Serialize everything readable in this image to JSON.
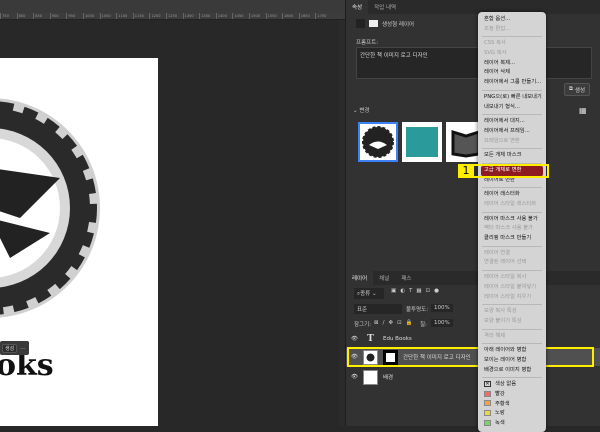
{
  "ruler": [
    "750",
    "800",
    "850",
    "900",
    "950",
    "1000",
    "1050",
    "1100",
    "1150",
    "1200",
    "1250",
    "1300",
    "1350",
    "1400",
    "1450",
    "1500",
    "1550",
    "1600",
    "1650",
    "1700"
  ],
  "canvas": {
    "text": "oks",
    "ctx_button": "생성",
    "ctx_more": "..."
  },
  "properties": {
    "tabs": [
      "속성",
      "작업 내역"
    ],
    "layer_type": "생성형 레이어",
    "prompt_label": "프롬프트:",
    "prompt_value": "간단한 책 이미지 로고 디자인",
    "generate_button": "생성",
    "variations_label": "변경"
  },
  "layers_panel": {
    "tabs": [
      "레이어",
      "채널",
      "패스"
    ],
    "filter": "종류",
    "blend_mode": "표준",
    "opacity_label": "불투명도:",
    "opacity": "100%",
    "lock_label": "잠그기:",
    "fill_label": "칠:",
    "fill": "100%",
    "layers": [
      {
        "name": "Edu Books",
        "type": "text"
      },
      {
        "name": "간단한 책 이미지 로고 디자인",
        "type": "generative",
        "selected": true
      },
      {
        "name": "배경",
        "type": "background"
      }
    ]
  },
  "annotation": {
    "step": "1"
  },
  "context_menu": [
    {
      "label": "혼합 옵션..."
    },
    {
      "label": "조정 편집...",
      "disabled": true
    },
    {
      "sep": true
    },
    {
      "label": "CSS 복사",
      "disabled": true
    },
    {
      "label": "SVG 복사",
      "disabled": true
    },
    {
      "label": "레이어 복제..."
    },
    {
      "label": "레이어 삭제"
    },
    {
      "label": "레이어에서 그룹 만들기..."
    },
    {
      "sep": true
    },
    {
      "label": "PNG으(로) 빠른 내보내기"
    },
    {
      "label": "내보내기 형식..."
    },
    {
      "sep": true
    },
    {
      "label": "레이어에서 대지..."
    },
    {
      "label": "레이어에서 프레임..."
    },
    {
      "label": "프레임으로 변환",
      "disabled": true
    },
    {
      "sep": true
    },
    {
      "label": "모든 개체 마스크"
    },
    {
      "sep": true
    },
    {
      "label": "고급 개체로 변환",
      "highlighted": true
    },
    {
      "label": "레이어로 변환"
    },
    {
      "sep": true
    },
    {
      "label": "레이어 래스터화"
    },
    {
      "label": "레이어 스타일 래스터화",
      "disabled": true
    },
    {
      "sep": true
    },
    {
      "label": "레이어 마스크 사용 불가"
    },
    {
      "label": "벡터 마스크 사용 불가",
      "disabled": true
    },
    {
      "label": "클리핑 마스크 만들기"
    },
    {
      "sep": true
    },
    {
      "label": "레이어 연결",
      "disabled": true
    },
    {
      "label": "연결된 레이어 선택",
      "disabled": true
    },
    {
      "sep": true
    },
    {
      "label": "레이어 스타일 복사",
      "disabled": true
    },
    {
      "label": "레이어 스타일 붙여넣기",
      "disabled": true
    },
    {
      "label": "레이어 스타일 지우기",
      "disabled": true
    },
    {
      "sep": true
    },
    {
      "label": "모양 복사 특성",
      "disabled": true
    },
    {
      "label": "모양 붙이기 특성",
      "disabled": true
    },
    {
      "sep": true
    },
    {
      "label": "격리 해제",
      "disabled": true
    },
    {
      "sep": true
    },
    {
      "label": "아래 레이어와 병합"
    },
    {
      "label": "보이는 레이어 병합"
    },
    {
      "label": "배경으로 이미지 병합"
    },
    {
      "sep": true
    },
    {
      "label": "색상 없음",
      "swatch": "none"
    },
    {
      "label": "빨강",
      "swatch": "#f26b6b"
    },
    {
      "label": "주황색",
      "swatch": "#f5a04a"
    },
    {
      "label": "노랑",
      "swatch": "#e8d84a"
    },
    {
      "label": "녹색",
      "swatch": "#7dd36b"
    }
  ]
}
